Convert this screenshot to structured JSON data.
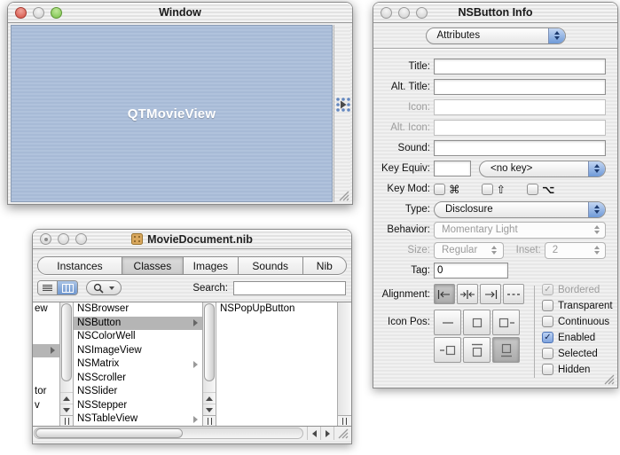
{
  "colors": {
    "aqua_blue": "#7fa3dd",
    "movie_view_blue": "#a9bdd6",
    "selection_gray": "#b5b5b5",
    "tab_selected_gray": "#d2d2d2"
  },
  "movie_window": {
    "title": "Window",
    "view_label": "QTMovieView"
  },
  "nib": {
    "title": "MovieDocument.nib",
    "tabs": [
      {
        "label": "Instances",
        "selected": false
      },
      {
        "label": "Classes",
        "selected": true
      },
      {
        "label": "Images",
        "selected": false
      },
      {
        "label": "Sounds",
        "selected": false
      },
      {
        "label": "Nib",
        "selected": false
      }
    ],
    "toolbar": {
      "search_label": "Search:",
      "search_value": ""
    },
    "browser": {
      "left_fragments": {
        "row1": "ew",
        "row7": "tor",
        "row8": "v"
      },
      "classes": [
        {
          "name": "NSBrowser",
          "selected": false,
          "expandable": false
        },
        {
          "name": "NSButton",
          "selected": true,
          "expandable": true
        },
        {
          "name": "NSColorWell",
          "selected": false,
          "expandable": false
        },
        {
          "name": "NSImageView",
          "selected": false,
          "expandable": false
        },
        {
          "name": "NSMatrix",
          "selected": false,
          "expandable": true
        },
        {
          "name": "NSScroller",
          "selected": false,
          "expandable": false
        },
        {
          "name": "NSSlider",
          "selected": false,
          "expandable": false
        },
        {
          "name": "NSStepper",
          "selected": false,
          "expandable": false
        },
        {
          "name": "NSTableView",
          "selected": false,
          "expandable": true
        }
      ],
      "subclasses": [
        {
          "name": "NSPopUpButton"
        }
      ]
    }
  },
  "inspector": {
    "title": "NSButton Info",
    "pane_popup": "Attributes",
    "fields": {
      "title": {
        "label": "Title:",
        "value": "",
        "disabled": false
      },
      "alt_title": {
        "label": "Alt. Title:",
        "value": "",
        "disabled": false
      },
      "icon": {
        "label": "Icon:",
        "value": "",
        "disabled": true
      },
      "alt_icon": {
        "label": "Alt. Icon:",
        "value": "",
        "disabled": true
      },
      "sound": {
        "label": "Sound:",
        "value": "",
        "disabled": false
      }
    },
    "key_equiv": {
      "label": "Key Equiv:",
      "value": "",
      "popup_value": "<no key>"
    },
    "key_mod": {
      "label": "Key Mod:",
      "mods": [
        {
          "symbol": "⌘",
          "checked": false
        },
        {
          "symbol": "⇧",
          "checked": false
        },
        {
          "symbol": "⌥",
          "checked": false
        }
      ]
    },
    "type_row": {
      "label": "Type:",
      "value": "Disclosure"
    },
    "behavior": {
      "label": "Behavior:",
      "value": "Momentary Light",
      "disabled": true
    },
    "size": {
      "label": "Size:",
      "value": "Regular",
      "disabled": true
    },
    "inset": {
      "label": "Inset:",
      "value": "2",
      "disabled": true
    },
    "tag": {
      "label": "Tag:",
      "value": "0"
    },
    "alignment": {
      "label": "Alignment:",
      "options": [
        {
          "name": "align-left",
          "selected": true
        },
        {
          "name": "align-center",
          "selected": false
        },
        {
          "name": "align-right",
          "selected": false
        },
        {
          "name": "align-dashes",
          "selected": false
        }
      ]
    },
    "icon_pos": {
      "label": "Icon Pos:",
      "options": [
        {
          "name": "text-only",
          "selected": false
        },
        {
          "name": "icon-only",
          "selected": false
        },
        {
          "name": "icon-left",
          "selected": false
        },
        {
          "name": "icon-right",
          "selected": false
        },
        {
          "name": "icon-below",
          "selected": false
        },
        {
          "name": "icon-above",
          "selected": true
        }
      ]
    },
    "checkboxes": [
      {
        "label": "Bordered",
        "checked": true,
        "disabled": true
      },
      {
        "label": "Transparent",
        "checked": false,
        "disabled": false
      },
      {
        "label": "Continuous",
        "checked": false,
        "disabled": false
      },
      {
        "label": "Enabled",
        "checked": true,
        "disabled": false
      },
      {
        "label": "Selected",
        "checked": false,
        "disabled": false
      },
      {
        "label": "Hidden",
        "checked": false,
        "disabled": false
      }
    ]
  }
}
